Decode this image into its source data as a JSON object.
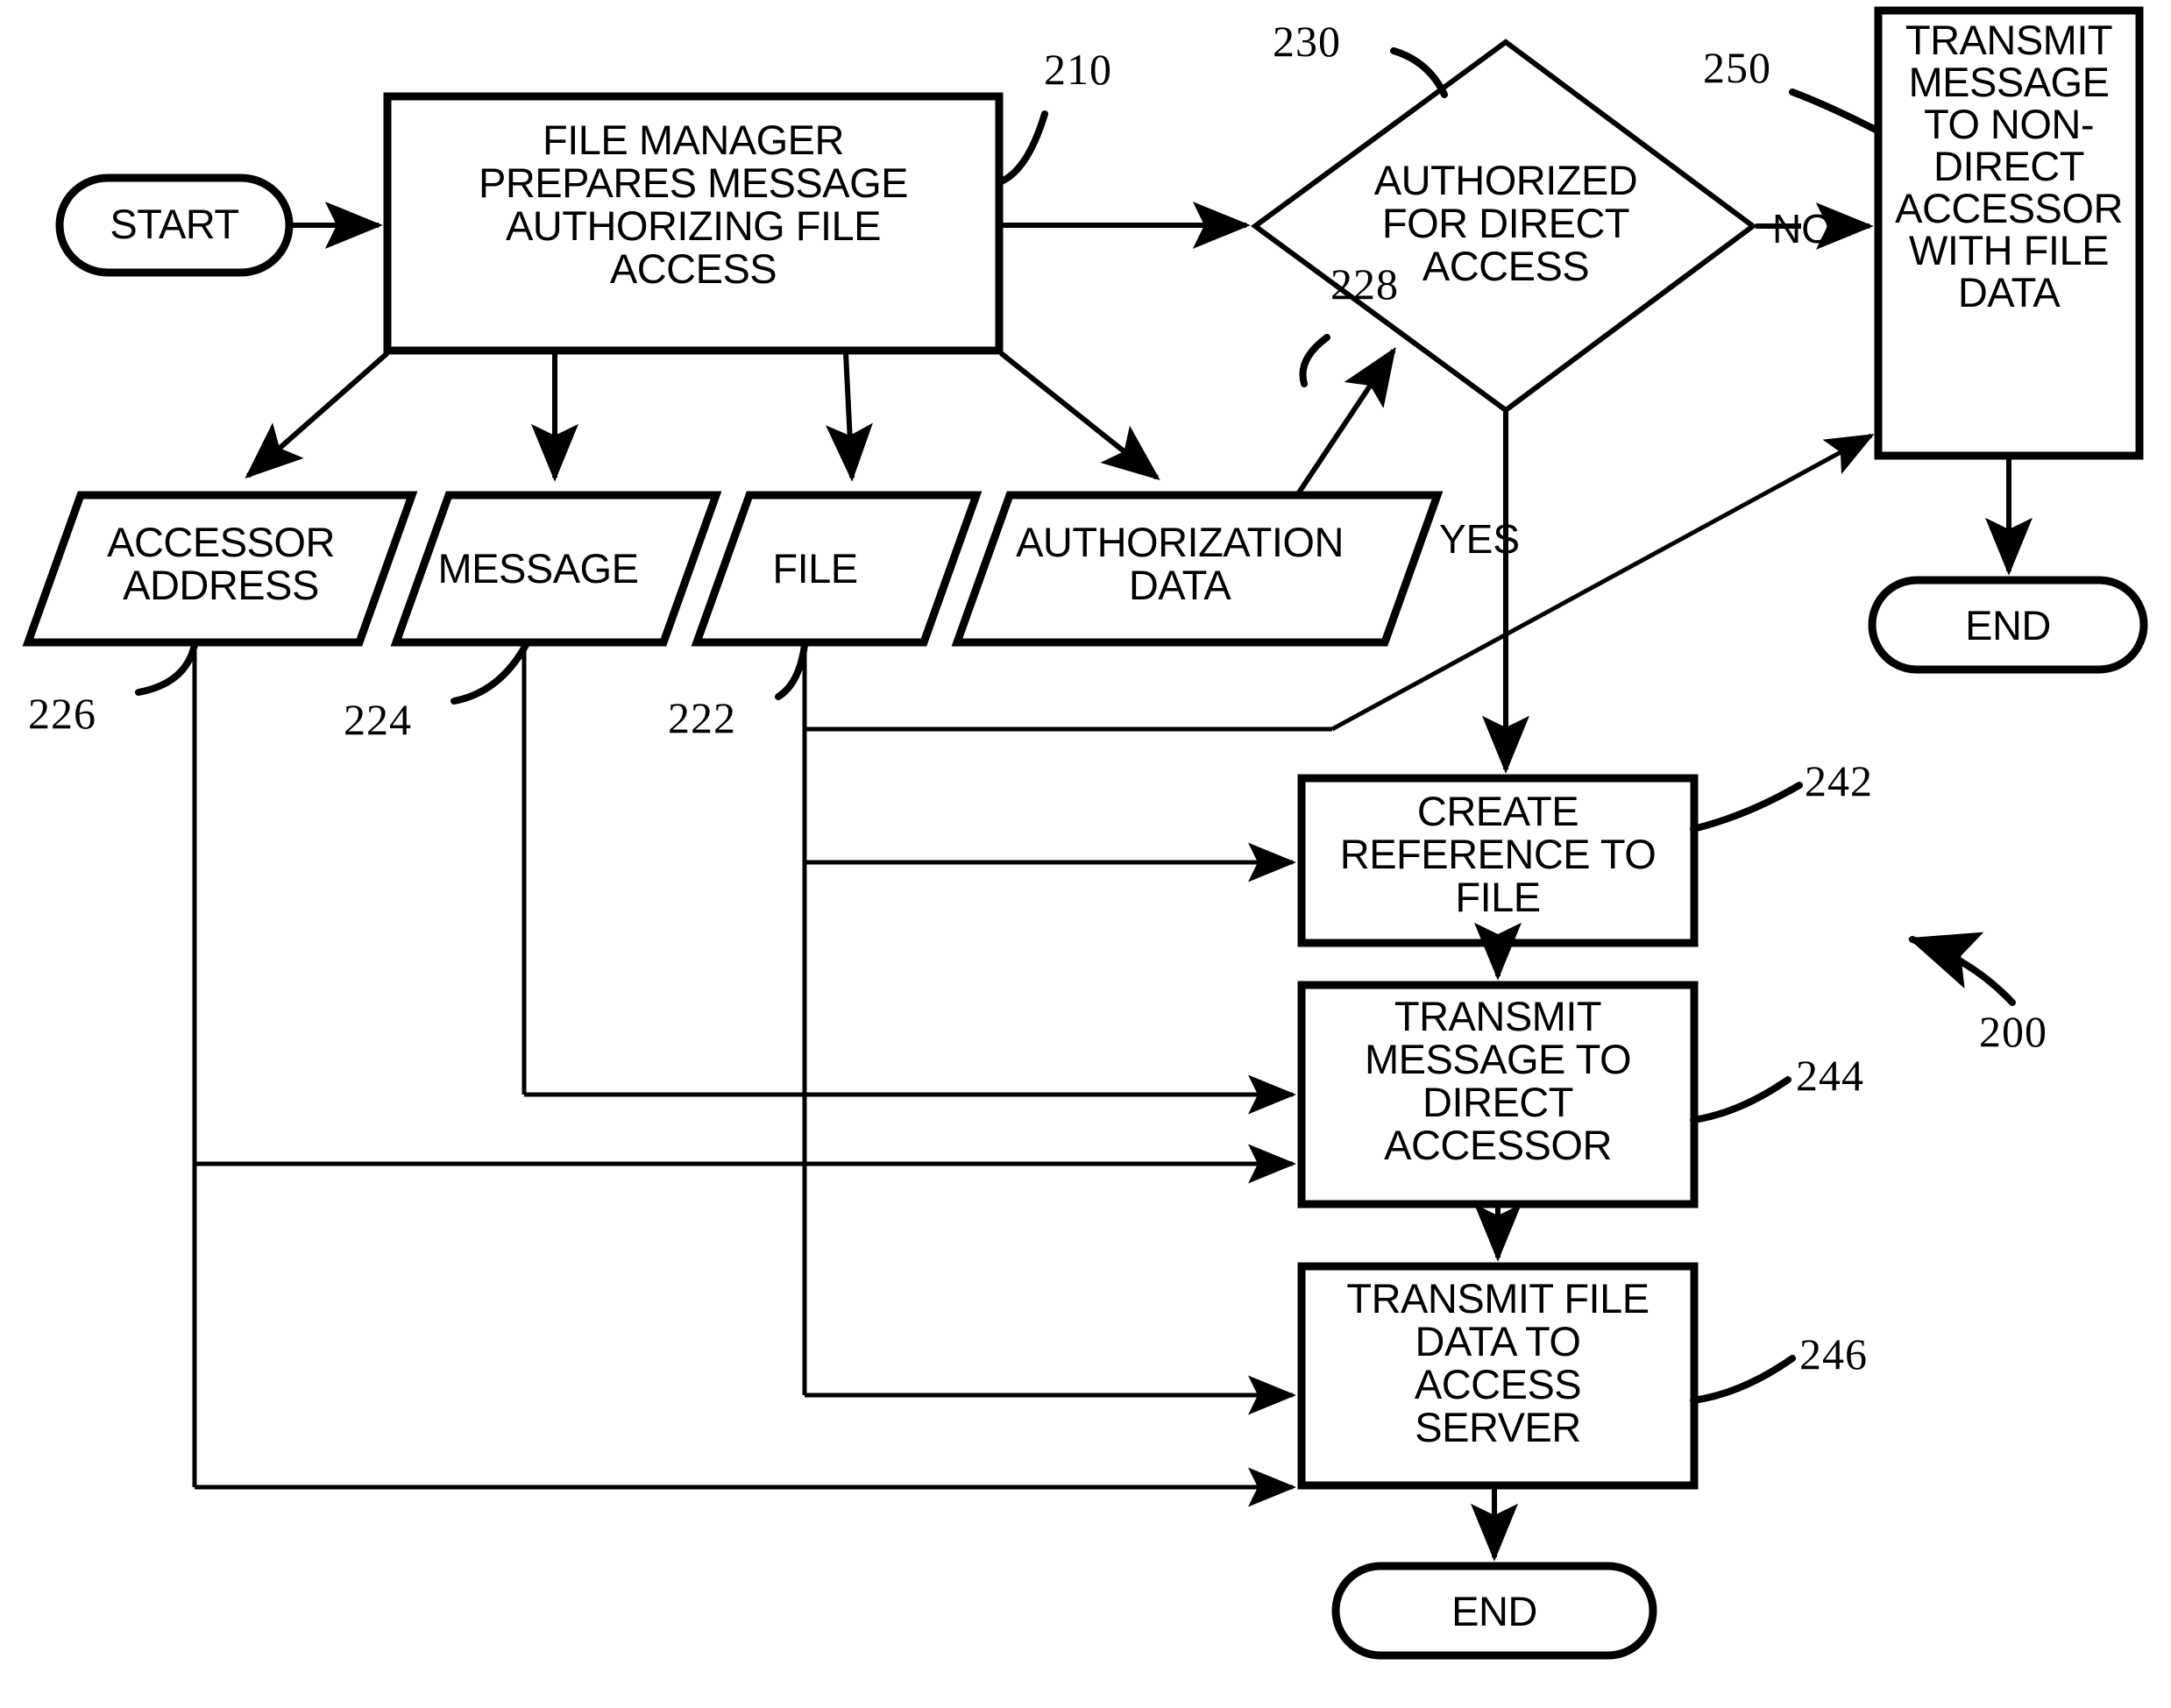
{
  "figure": {
    "title": "File access authorization flowchart",
    "figure_ref": "200"
  },
  "nodes": {
    "start": {
      "label": "START",
      "shape": "terminator"
    },
    "step210": {
      "label": "FILE MANAGER\nPREPARES MESSAGE\nAUTHORIZING FILE\nACCESS",
      "ref": "210",
      "shape": "process"
    },
    "decision230": {
      "label": "AUTHORIZED\nFOR DIRECT\nACCESS",
      "ref": "230",
      "shape": "decision"
    },
    "step250": {
      "label": "TRANSMIT\nMESSAGE\nTO NON-\nDIRECT\nACCESSOR\nWITH FILE\nDATA",
      "ref": "250",
      "shape": "process"
    },
    "end_right": {
      "label": "END",
      "shape": "terminator"
    },
    "data226": {
      "label": "ACCESSOR\nADDRESS",
      "ref": "226",
      "shape": "data"
    },
    "data224": {
      "label": "MESSAGE",
      "ref": "224",
      "shape": "data"
    },
    "data222": {
      "label": "FILE",
      "ref": "222",
      "shape": "data"
    },
    "data228": {
      "label": "AUTHORIZATION\nDATA",
      "ref": "228",
      "shape": "data"
    },
    "step242": {
      "label": "CREATE\nREFERENCE TO\nFILE",
      "ref": "242",
      "shape": "process"
    },
    "step244": {
      "label": "TRANSMIT\nMESSAGE TO\nDIRECT\nACCESSOR",
      "ref": "244",
      "shape": "process"
    },
    "step246": {
      "label": "TRANSMIT FILE\nDATA TO\nACCESS\nSERVER",
      "ref": "246",
      "shape": "process"
    },
    "end_bottom": {
      "label": "END",
      "shape": "terminator"
    }
  },
  "edge_labels": {
    "no": "NO",
    "yes": "YES"
  },
  "reference_numerals": {
    "r210": "210",
    "r222": "222",
    "r224": "224",
    "r226": "226",
    "r228": "228",
    "r230": "230",
    "r242": "242",
    "r244": "244",
    "r246": "246",
    "r250": "250",
    "r200": "200"
  },
  "colors": {
    "stroke": "#000000",
    "background": "#ffffff"
  }
}
